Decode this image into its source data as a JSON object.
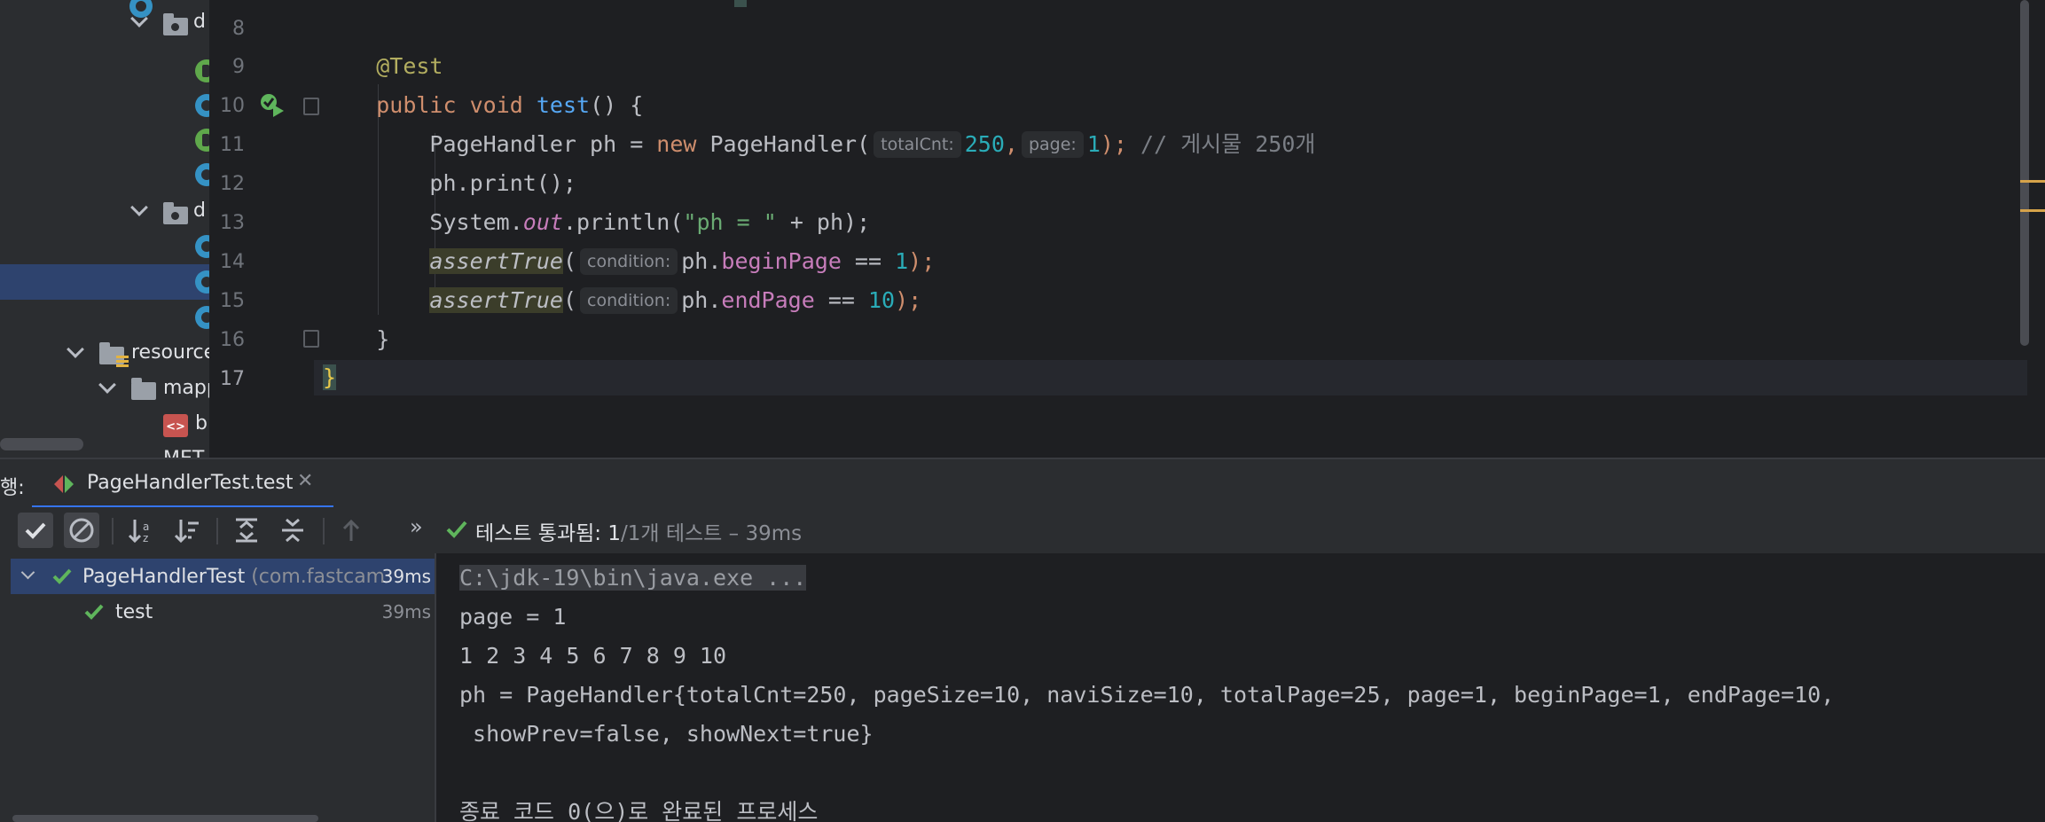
{
  "project_tree": {
    "items": [
      {
        "label": "d",
        "kind": "folder"
      },
      {
        "label": "",
        "kind": "class-green"
      },
      {
        "label": "",
        "kind": "class"
      },
      {
        "label": "",
        "kind": "class-green"
      },
      {
        "label": "",
        "kind": "class"
      },
      {
        "label": "d",
        "kind": "folder"
      },
      {
        "label": "",
        "kind": "class"
      },
      {
        "label": "",
        "kind": "class"
      },
      {
        "label": "",
        "kind": "class"
      },
      {
        "label": "resource",
        "kind": "resources-folder"
      },
      {
        "label": "mapp",
        "kind": "folder"
      },
      {
        "label": "b",
        "kind": "xml-file"
      },
      {
        "label": "MET",
        "kind": "folder"
      }
    ]
  },
  "editor": {
    "line_numbers": [
      "8",
      "9",
      "10",
      "11",
      "12",
      "13",
      "14",
      "15",
      "16",
      "17"
    ],
    "current_line": "17",
    "code": {
      "l9_annotation": "@Test",
      "l10_public": "public",
      "l10_void": "void",
      "l10_method": "test",
      "l10_rest": "() {",
      "l11_type": "PageHandler ph = ",
      "l11_new": "new",
      "l11_ctor": " PageHandler(",
      "l11_hint1": "totalCnt:",
      "l11_arg1": "250",
      "l11_comma": ",",
      "l11_hint2": "page:",
      "l11_arg2": "1",
      "l11_end": ");",
      "l11_comment": " // 게시물 250개",
      "l12": "ph.print();",
      "l13_a": "System.",
      "l13_out": "out",
      "l13_b": ".println(",
      "l13_str": "\"ph = \"",
      "l13_c": " + ph);",
      "l14_assert": "assertTrue",
      "l14_open": "(",
      "l14_hint": "condition:",
      "l14_a": "ph.",
      "l14_field": "beginPage",
      "l14_op": " == ",
      "l14_num": "1",
      "l14_end": ");",
      "l15_assert": "assertTrue",
      "l15_open": "(",
      "l15_hint": "condition:",
      "l15_a": "ph.",
      "l15_field": "endPage",
      "l15_op": " == ",
      "l15_num": "10",
      "l15_end": ");",
      "l16": "}",
      "l17": "}"
    }
  },
  "run_panel": {
    "label": "행:",
    "tab_title": "PageHandlerTest.test",
    "tab_close": "✕",
    "status_passed": "테스트 통과됨:",
    "status_count": "1",
    "status_rest": "/1개 테스트 – 39ms",
    "more_glyph": "»",
    "tests": [
      {
        "name": "PageHandlerTest",
        "pkg": "(com.fastcamp",
        "time": "39ms"
      },
      {
        "name": "test",
        "pkg": "",
        "time": "39ms"
      }
    ],
    "console": [
      "C:\\jdk-19\\bin\\java.exe ...",
      "page = 1",
      "1 2 3 4 5 6 7 8 9 10",
      "ph = PageHandler{totalCnt=250, pageSize=10, naviSize=10, totalPage=25, page=1, beginPage=1, endPage=10,",
      " showPrev=false, showNext=true}",
      "",
      "종료 코드 0(으)로 완료된 프로세스"
    ]
  },
  "colors": {
    "accent": "#3574f0",
    "pass_green": "#5fb55c",
    "keyword": "#cf8e6d",
    "number": "#2aacb8",
    "string": "#6aab73"
  }
}
